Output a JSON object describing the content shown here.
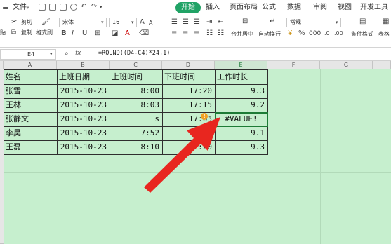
{
  "menubar": {
    "file_label": "文件",
    "tabs": [
      "开始",
      "插入",
      "页面布局",
      "公式",
      "数据",
      "审阅",
      "视图",
      "开发工具"
    ],
    "active_tab": "开始"
  },
  "toolbar": {
    "cut": "剪切",
    "copy": "复制",
    "format_painter": "格式刷",
    "paste_partial": "贴",
    "font_name": "宋体",
    "font_size": "16",
    "merge_center": "合并居中",
    "wrap_text": "自动换行",
    "number_format": "常规",
    "conditional_format": "条件格式",
    "table_style": "表格"
  },
  "formula_bar": {
    "cell_ref": "E4",
    "fx": "fx",
    "formula": "=ROUND((D4-C4)*24,1)"
  },
  "sheet": {
    "columns": [
      "A",
      "B",
      "C",
      "D",
      "E",
      "F",
      "G"
    ],
    "selected_column": "E",
    "headers": [
      "姓名",
      "上班日期",
      "上班时间",
      "下班时间",
      "工作时长"
    ],
    "rows": [
      [
        "张雪",
        "2015-10-23",
        "8:00",
        "17:20",
        "9.3"
      ],
      [
        "王林",
        "2015-10-23",
        "8:03",
        "17:15",
        "9.2"
      ],
      [
        "张静文",
        "2015-10-23",
        "s",
        "17:03",
        "#VALUE!"
      ],
      [
        "李昊",
        "2015-10-23",
        "7:52",
        "17:00",
        "9.1"
      ],
      [
        "王磊",
        "2015-10-23",
        "8:10",
        "17:20",
        "9.3"
      ]
    ],
    "error_marker": "!"
  },
  "colors": {
    "accent": "#21a366",
    "sheet_bg": "#c6efce",
    "arrow": "#e8261f"
  }
}
